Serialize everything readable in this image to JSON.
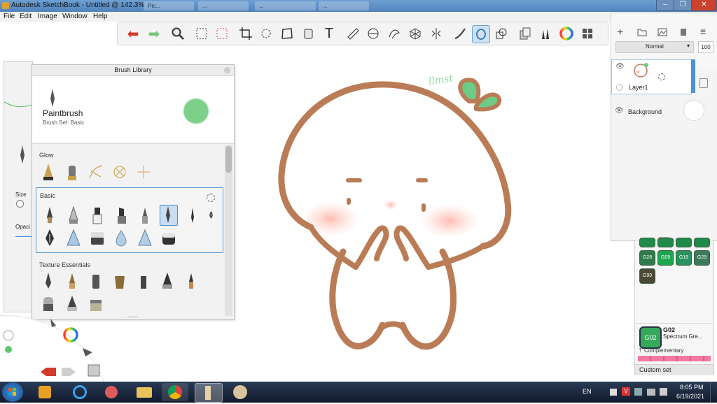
{
  "window": {
    "title": "Autodesk SketchBook - Untitled @ 142.3%",
    "background_tabs": [
      "Pic...",
      "...",
      "...",
      "..."
    ]
  },
  "menu": [
    "File",
    "Edit",
    "Image",
    "Window",
    "Help"
  ],
  "toolbar": {
    "icons": [
      "undo-icon",
      "redo-icon",
      "zoom-icon",
      "select-rect-icon",
      "select-lasso-icon",
      "crop-icon",
      "transform-icon",
      "distort-icon",
      "fill-icon",
      "text-icon",
      "ruler-icon",
      "ellipse-guide-icon",
      "french-curve-icon",
      "perspective-icon",
      "symmetry-icon",
      "stroke-icon",
      "predictive-stroke-icon",
      "shape-icon",
      "copy-icon",
      "brush-library-icon",
      "color-wheel-icon",
      "grid-icon"
    ],
    "active": "predictive-stroke-icon"
  },
  "brush_library": {
    "header": "Brush Library",
    "current_brush": "Paintbrush",
    "current_set": "Brush Set: Basic",
    "current_color": "#7cd08a",
    "sections": [
      {
        "title": "Glow",
        "count": 5
      },
      {
        "title": "Basic",
        "count": 13
      },
      {
        "title": "Texture Essentials",
        "count": 10
      }
    ]
  },
  "side_panel": {
    "size_label": "Size",
    "opacity_label": "Opaci"
  },
  "layers": {
    "blend_mode": "Normal",
    "opacity": "100",
    "items": [
      {
        "name": "Layer1",
        "selected": true
      },
      {
        "name": "Background",
        "selected": false
      }
    ]
  },
  "colors": {
    "swatches": [
      "G28",
      "G09",
      "G19",
      "G29",
      "G99"
    ],
    "selected_code": "G02",
    "selected_name": "Spectrum Gre...",
    "complementary_label": "Complementary",
    "custom_set_label": "Custom set",
    "selected_color": "#36a85b"
  },
  "canvas": {
    "signature": "llmst",
    "stroke_color": "#b97c56",
    "leaf_color": "#6ccc85"
  },
  "taskbar": {
    "language": "EN",
    "time": "8:05 PM",
    "date": "6/19/2021"
  }
}
